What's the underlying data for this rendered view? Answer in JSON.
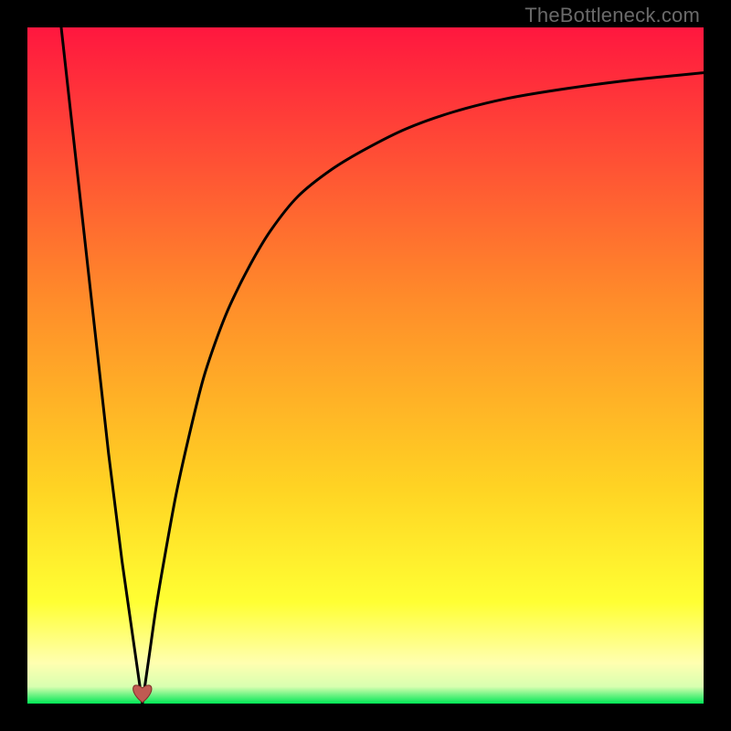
{
  "watermark": "TheBottleneck.com",
  "colors": {
    "gradient_top": "#ff173f",
    "gradient_mid_upper": "#ff8b2a",
    "gradient_mid": "#ffd323",
    "gradient_mid_lower": "#ffff33",
    "gradient_pale": "#ffffb0",
    "gradient_bottom": "#00e756",
    "curve": "#000000",
    "marker_fill": "#c05a52",
    "marker_stroke": "#7f2d28",
    "frame_bg": "#000000"
  },
  "chart_data": {
    "type": "line",
    "title": "",
    "xlabel": "",
    "ylabel": "",
    "xlim": [
      0,
      100
    ],
    "ylim": [
      0,
      100
    ],
    "grid": false,
    "legend": false,
    "optimum_x": 17,
    "marker": {
      "x": 17,
      "y": 1.5,
      "shape": "heart"
    },
    "series": [
      {
        "name": "left-branch",
        "x": [
          5,
          6,
          7,
          8,
          9,
          10,
          11,
          12,
          13,
          14,
          15,
          16,
          17
        ],
        "y": [
          100,
          91,
          82,
          73,
          64,
          55,
          46,
          37,
          29,
          21,
          14,
          7,
          0
        ]
      },
      {
        "name": "right-branch",
        "x": [
          17,
          18,
          19,
          20,
          22,
          24,
          26,
          28,
          30,
          33,
          36,
          40,
          45,
          50,
          56,
          63,
          71,
          80,
          90,
          100
        ],
        "y": [
          0,
          7,
          14,
          20,
          31,
          40,
          48,
          54,
          59,
          65,
          70,
          75,
          79,
          82,
          85,
          87.5,
          89.5,
          91,
          92.3,
          93.3
        ]
      }
    ],
    "background_bands": [
      {
        "y0": 100,
        "y1": 60,
        "type": "gradient",
        "from": "#ff173f",
        "to": "#ff8b2a"
      },
      {
        "y0": 60,
        "y1": 30,
        "type": "gradient",
        "from": "#ff8b2a",
        "to": "#ffd323"
      },
      {
        "y0": 30,
        "y1": 12,
        "type": "gradient",
        "from": "#ffd323",
        "to": "#ffff33"
      },
      {
        "y0": 12,
        "y1": 4,
        "type": "gradient",
        "from": "#ffff33",
        "to": "#ffffb0"
      },
      {
        "y0": 4,
        "y1": 0,
        "type": "solid",
        "color": "#00e756"
      }
    ]
  }
}
